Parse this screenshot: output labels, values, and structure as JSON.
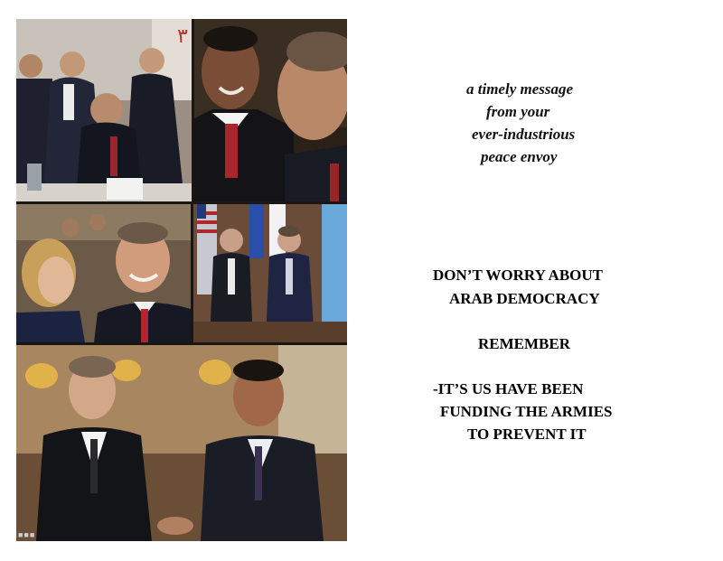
{
  "message": {
    "lines": [
      "a timely message",
      "from your",
      "ever-industrious",
      "peace envoy"
    ]
  },
  "statement": {
    "line1": "DON’T WORRY ABOUT",
    "line2": "ARAB DEMOCRACY",
    "line3": "REMEMBER",
    "line4": "-IT’S US HAVE BEEN",
    "line5": "FUNDING THE ARMIES",
    "line6": "TO PREVENT IT"
  },
  "photos": {
    "summit_sign": "٣"
  },
  "colors": {
    "background": "#ffffff",
    "text": "#000000",
    "collage_border": "#1a1612"
  }
}
